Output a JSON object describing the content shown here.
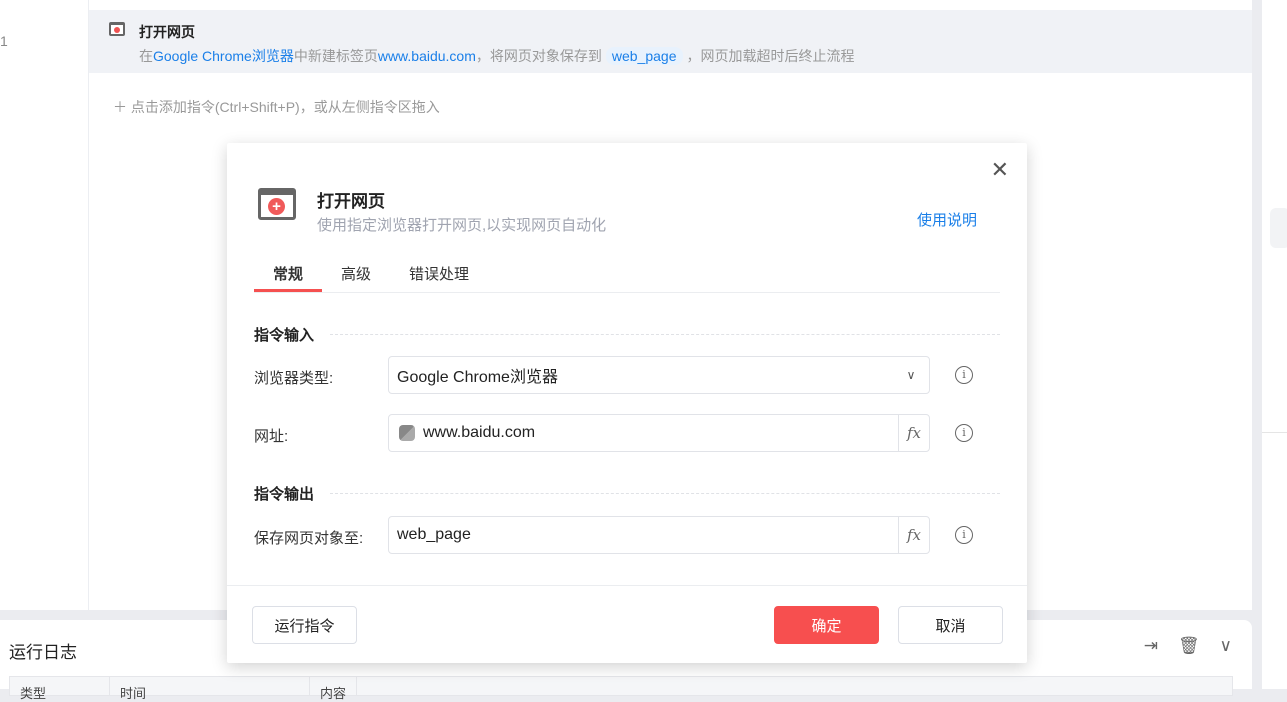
{
  "editor": {
    "line_number": "1",
    "step": {
      "title": "打开网页",
      "desc_prefix": "在",
      "desc_browser": "Google Chrome浏览器",
      "desc_mid": "中新建标签页",
      "desc_url": "www.baidu.com",
      "desc_mid2": "，将网页对象保存到",
      "desc_var": "web_page",
      "desc_suffix": "，网页加载超时后终止流程"
    },
    "add_hint": "点击添加指令(Ctrl+Shift+P)，或从左侧指令区拖入"
  },
  "log": {
    "title": "运行日志",
    "columns": [
      "类型",
      "时间",
      "内容"
    ]
  },
  "dialog": {
    "title": "打开网页",
    "subtitle": "使用指定浏览器打开网页,以实现网页自动化",
    "help": "使用说明",
    "tabs": [
      "常规",
      "高级",
      "错误处理"
    ],
    "section_input": "指令输入",
    "section_output": "指令输出",
    "browser_label": "浏览器类型:",
    "browser_value": "Google Chrome浏览器",
    "url_label": "网址:",
    "url_value": "www.baidu.com",
    "save_label": "保存网页对象至:",
    "save_value": "web_page",
    "fx": "fx",
    "run": "运行指令",
    "ok": "确定",
    "cancel": "取消"
  },
  "colors": {
    "accent": "#f74f4f",
    "link": "#1a7fe8"
  }
}
